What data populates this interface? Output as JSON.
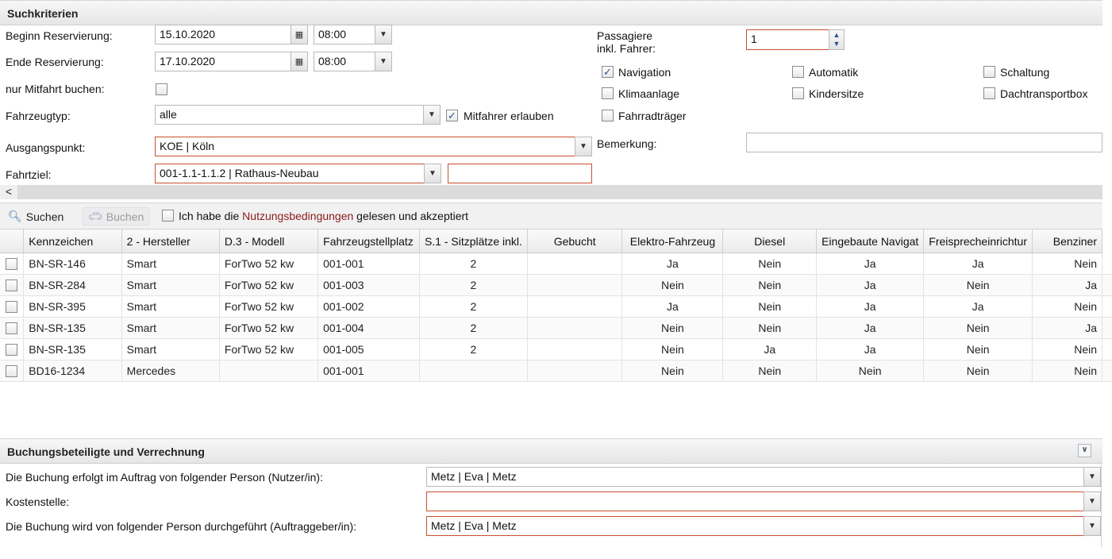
{
  "search_panel": {
    "title": "Suchkriterien",
    "begin_label": "Beginn Reservierung:",
    "begin_date": "15.10.2020",
    "begin_time": "08:00",
    "end_label": "Ende Reservierung:",
    "end_date": "17.10.2020",
    "end_time": "08:00",
    "ride_only_label": "nur Mitfahrt buchen:",
    "vehicle_type_label": "Fahrzeugtyp:",
    "vehicle_type_value": "alle",
    "allow_passengers_label": "Mitfahrer erlauben",
    "start_label": "Ausgangspunkt:",
    "start_value": "KOE | Köln",
    "destination_label": "Fahrtziel:",
    "destination_value": "001-1.1-1.1.2 | Rathaus-Neubau",
    "passengers_label_line1": "Passagiere",
    "passengers_label_line2": "inkl. Fahrer:",
    "passengers_value": "1",
    "remark_label": "Bemerkung:",
    "options": [
      {
        "label": "Navigation",
        "checked": true
      },
      {
        "label": "Automatik",
        "checked": false
      },
      {
        "label": "Schaltung",
        "checked": false
      },
      {
        "label": "Klimaanlage",
        "checked": false
      },
      {
        "label": "Kindersitze",
        "checked": false
      },
      {
        "label": "Dachtransportbox",
        "checked": false
      },
      {
        "label": "Fahrradträger",
        "checked": false
      }
    ]
  },
  "toolbar": {
    "search_label": "Suchen",
    "book_label": "Buchen",
    "terms_prefix": "Ich habe die ",
    "terms_link": "Nutzungsbedingungen",
    "terms_suffix": " gelesen und akzeptiert"
  },
  "grid": {
    "columns": [
      "Kennzeichen",
      "2 - Hersteller",
      "D.3 - Modell",
      "Fahrzeugstellplatz",
      "S.1 - Sitzplätze inkl.",
      "Gebucht",
      "Elektro-Fahrzeug",
      "Diesel",
      "Eingebaute Navigat",
      "Freisprecheinrichtur",
      "Benziner"
    ],
    "rows": [
      [
        "BN-SR-146",
        "Smart",
        "ForTwo 52 kw",
        "001-001",
        "2",
        "",
        "Ja",
        "Nein",
        "Ja",
        "Ja",
        "Nein"
      ],
      [
        "BN-SR-284",
        "Smart",
        "ForTwo 52 kw",
        "001-003",
        "2",
        "",
        "Nein",
        "Nein",
        "Ja",
        "Nein",
        "Ja"
      ],
      [
        "BN-SR-395",
        "Smart",
        "ForTwo 52 kw",
        "001-002",
        "2",
        "",
        "Ja",
        "Nein",
        "Ja",
        "Ja",
        "Nein"
      ],
      [
        "BN-SR-135",
        "Smart",
        "ForTwo 52 kw",
        "001-004",
        "2",
        "",
        "Nein",
        "Nein",
        "Ja",
        "Nein",
        "Ja"
      ],
      [
        "BN-SR-135",
        "Smart",
        "ForTwo 52 kw",
        "001-005",
        "2",
        "",
        "Nein",
        "Ja",
        "Ja",
        "Nein",
        "Nein"
      ],
      [
        "BD16-1234",
        "Mercedes",
        "",
        "001-001",
        "",
        "",
        "Nein",
        "Nein",
        "Nein",
        "Nein",
        "Nein"
      ]
    ]
  },
  "booking_panel": {
    "title": "Buchungsbeteiligte und Verrechnung",
    "on_behalf_label": "Die Buchung erfolgt im Auftrag von folgender Person (Nutzer/in):",
    "on_behalf_value": "Metz | Eva | Metz",
    "cost_center_label": "Kostenstelle:",
    "cost_center_value": "",
    "performed_by_label": "Die Buchung wird von folgender Person durchgeführt (Auftraggeber/in):",
    "performed_by_value": "Metz | Eva | Metz"
  }
}
